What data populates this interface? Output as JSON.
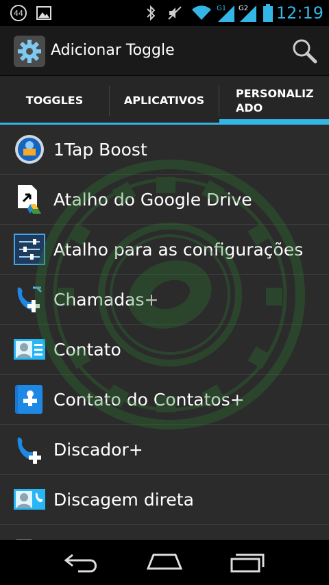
{
  "status_bar": {
    "notification_count": "44",
    "sim1_label": "G1",
    "sim2_label": "G2",
    "time": "12:19",
    "icons": [
      "notification-count-icon",
      "image-icon",
      "bluetooth-icon",
      "mute-icon",
      "wifi-icon",
      "signal-sim1-icon",
      "signal-sim2-icon",
      "battery-icon"
    ]
  },
  "action_bar": {
    "title": "Adicionar Toggle",
    "app_icon": "settings-gear-icon",
    "search_icon": "search-icon"
  },
  "tabs": [
    {
      "label": "TOGGLES",
      "selected": false
    },
    {
      "label": "APLICATIVOS",
      "selected": false
    },
    {
      "label": "PERSONALIZ\nADO",
      "selected": true
    }
  ],
  "list": {
    "items": [
      {
        "label": "1Tap Boost",
        "icon": "boost-icon"
      },
      {
        "label": "Atalho do Google Drive",
        "icon": "google-drive-shortcut-icon"
      },
      {
        "label": "Atalho para as configurações",
        "icon": "settings-shortcut-icon"
      },
      {
        "label": "Chamadas+",
        "icon": "calls-plus-icon"
      },
      {
        "label": "Contato",
        "icon": "contact-card-icon"
      },
      {
        "label": "Contato do Contatos+",
        "icon": "contacts-plus-icon"
      },
      {
        "label": "Discador+",
        "icon": "dialer-plus-icon"
      },
      {
        "label": "Discagem direta",
        "icon": "direct-dial-icon"
      }
    ]
  },
  "colors": {
    "accent": "#33b5e5",
    "background": "#2b2b2b",
    "watermark": "#2e7d32"
  },
  "nav_bar": {
    "buttons": [
      "back-icon",
      "home-icon",
      "recents-icon"
    ]
  }
}
